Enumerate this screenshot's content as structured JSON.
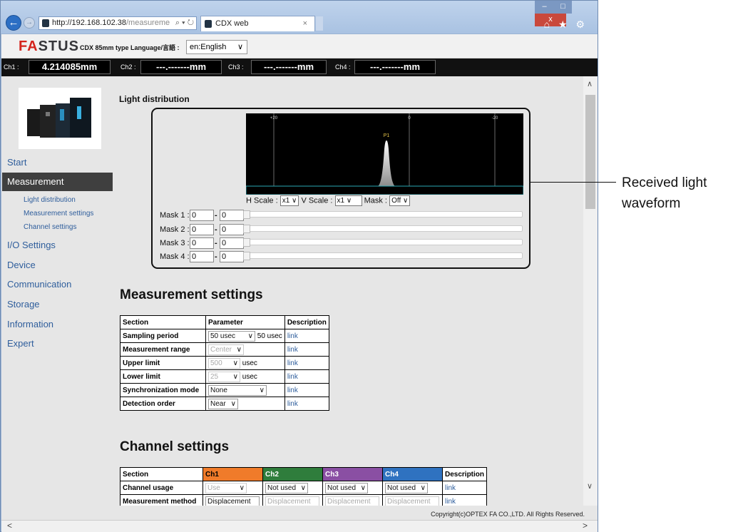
{
  "browser": {
    "url_host": "http://192.168.102.38",
    "url_path": "/measureme",
    "url_tools": "⌕ ▾ ↻",
    "tab_title": "CDX web",
    "tab_close": "×",
    "window_controls": {
      "minimize": "–",
      "maximize": "□",
      "close": "x"
    },
    "toolbar_icons": "⌂ ★ ⚙"
  },
  "header": {
    "logo": "FASTUS",
    "logo_a": "FA",
    "logo_b": "STUS",
    "model_text": "CDX 85mm type  Language/言語 :",
    "language_selected": "en:English"
  },
  "channels": [
    {
      "label": "Ch1 :",
      "value": "4.214085mm"
    },
    {
      "label": "Ch2 :",
      "value": "---.-------mm"
    },
    {
      "label": "Ch3 :",
      "value": "---.-------mm"
    },
    {
      "label": "Ch4 :",
      "value": "---.-------mm"
    }
  ],
  "sidebar": {
    "items": [
      "Start",
      "Measurement",
      "I/O Settings",
      "Device",
      "Communication",
      "Storage",
      "Information",
      "Expert"
    ],
    "active": "Measurement",
    "subitems": [
      "Light distribution",
      "Measurement settings",
      "Channel settings"
    ]
  },
  "light_distribution": {
    "title": "Light distribution",
    "axis_ticks": [
      "+20",
      "0",
      "-20"
    ],
    "peak_label": "P1",
    "h_scale_label": "H Scale :",
    "h_scale": "x1",
    "v_scale_label": "V Scale :",
    "v_scale": "x1",
    "mask_label": "Mask :",
    "mask_state": "Off",
    "masks": [
      {
        "label": "Mask 1 :",
        "from": "0",
        "to": "0"
      },
      {
        "label": "Mask 2 :",
        "from": "0",
        "to": "0"
      },
      {
        "label": "Mask 3 :",
        "from": "0",
        "to": "0"
      },
      {
        "label": "Mask 4 :",
        "from": "0",
        "to": "0"
      }
    ],
    "mask_dash": "-"
  },
  "measurement_settings": {
    "title": "Measurement settings",
    "headers": [
      "Section",
      "Parameter",
      "Description"
    ],
    "rows": [
      {
        "section": "Sampling period",
        "param": "50 usec",
        "extra": "50 usec",
        "disabled": false,
        "link": "link"
      },
      {
        "section": "Measurement range",
        "param": "Center",
        "extra": "",
        "disabled": true,
        "link": "link"
      },
      {
        "section": "Upper limit",
        "param": "500",
        "extra": "usec",
        "disabled": true,
        "link": "link"
      },
      {
        "section": "Lower limit",
        "param": "25",
        "extra": "usec",
        "disabled": true,
        "link": "link"
      },
      {
        "section": "Synchronization mode",
        "param": "None",
        "extra": "",
        "disabled": false,
        "link": "link"
      },
      {
        "section": "Detection order",
        "param": "Near",
        "extra": "",
        "disabled": false,
        "link": "link"
      }
    ]
  },
  "channel_settings": {
    "title": "Channel settings",
    "headers": [
      "Section",
      "Ch1",
      "Ch2",
      "Ch3",
      "Ch4",
      "Description"
    ],
    "header_colors": [
      "#ffffff",
      "#f07b2a",
      "#2f7d3c",
      "#8a4fa3",
      "#2f72c0",
      "#ffffff"
    ],
    "rows": [
      {
        "section": "Channel usage",
        "values": [
          "Use",
          "Not used",
          "Not used",
          "Not used"
        ],
        "link": "link"
      },
      {
        "section": "Measurement method",
        "values": [
          "Displacement",
          "Displacement",
          "Displacement",
          "Displacement"
        ],
        "link": "link"
      }
    ]
  },
  "footer": {
    "copyright": "Copyright(c)OPTEX FA CO.,LTD. All Rights Reserved."
  },
  "annotation": {
    "line1": "Received light",
    "line2": "waveform"
  }
}
